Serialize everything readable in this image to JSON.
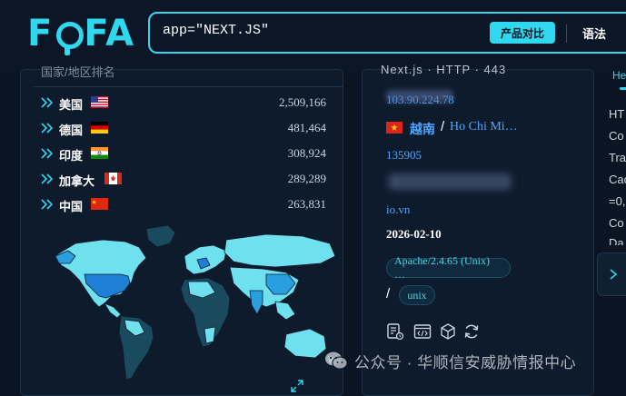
{
  "header": {
    "logo": "FOFA",
    "search_value": "app=\"NEXT.JS\"",
    "compare_label": "产品对比",
    "syntax_label": "语法"
  },
  "left_panel": {
    "heading": "国家/地区排名",
    "countries": [
      {
        "name": "美国",
        "count": "2,509,166",
        "flag": "us-flag"
      },
      {
        "name": "德国",
        "count": "481,464",
        "flag": "de-flag"
      },
      {
        "name": "印度",
        "count": "308,924",
        "flag": "in-flag"
      },
      {
        "name": "加拿大",
        "count": "289,289",
        "flag": "ca-flag"
      },
      {
        "name": "中国",
        "count": "263,831",
        "flag": "cn-flag"
      }
    ]
  },
  "result": {
    "top_text": "Next.js · HTTP · 443",
    "ip": "103.90.224.78",
    "country": "越南",
    "city": "Ho Chi Mi…",
    "asn": "135905",
    "domain": "io.vn",
    "date": "2026-02-10",
    "tags": [
      "Apache/2.4.65 (Unix) …",
      "unix"
    ]
  },
  "right_panel": {
    "tab": "He",
    "lines": [
      "HT",
      "Co",
      "Tra",
      "Cac",
      "=0,",
      "Co",
      "Da"
    ]
  },
  "watermark": "公众号 · 华顺信安威胁情报中心",
  "colors": {
    "accent": "#2fd8ee",
    "link": "#4da6ff",
    "background": "#0a1422",
    "panel": "#0e1b2c"
  }
}
